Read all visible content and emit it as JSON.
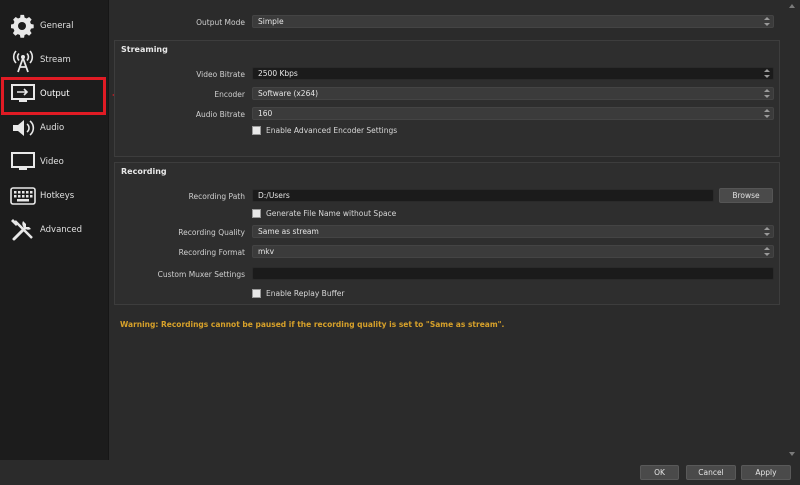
{
  "sidebar": {
    "items": [
      {
        "label": "General",
        "icon": "gear-icon"
      },
      {
        "label": "Stream",
        "icon": "antenna-icon"
      },
      {
        "label": "Output",
        "icon": "monitor-arrow-icon"
      },
      {
        "label": "Audio",
        "icon": "speaker-icon"
      },
      {
        "label": "Video",
        "icon": "monitor-icon"
      },
      {
        "label": "Hotkeys",
        "icon": "keyboard-icon"
      },
      {
        "label": "Advanced",
        "icon": "tools-icon"
      }
    ],
    "selected": "Output"
  },
  "output_mode": {
    "label": "Output Mode",
    "value": "Simple"
  },
  "streaming": {
    "title": "Streaming",
    "video_bitrate": {
      "label": "Video Bitrate",
      "value": "2500 Kbps"
    },
    "encoder": {
      "label": "Encoder",
      "value": "Software (x264)"
    },
    "audio_bitrate": {
      "label": "Audio Bitrate",
      "value": "160"
    },
    "advanced_encoder": {
      "label": "Enable Advanced Encoder Settings",
      "checked": false
    }
  },
  "recording": {
    "title": "Recording",
    "path": {
      "label": "Recording Path",
      "value": "D:/Users"
    },
    "browse_label": "Browse",
    "no_space": {
      "label": "Generate File Name without Space",
      "checked": false
    },
    "quality": {
      "label": "Recording Quality",
      "value": "Same as stream"
    },
    "format": {
      "label": "Recording Format",
      "value": "mkv"
    },
    "muxer": {
      "label": "Custom Muxer Settings",
      "value": ""
    },
    "replay_buffer": {
      "label": "Enable Replay Buffer",
      "checked": false
    }
  },
  "warning": "Warning: Recordings cannot be paused if the recording quality is set to \"Same as stream\".",
  "buttons": {
    "ok": "OK",
    "cancel": "Cancel",
    "apply": "Apply"
  },
  "colors": {
    "highlight": "#e01b24",
    "warning": "#d7a12a",
    "background": "#2b2b2b"
  }
}
